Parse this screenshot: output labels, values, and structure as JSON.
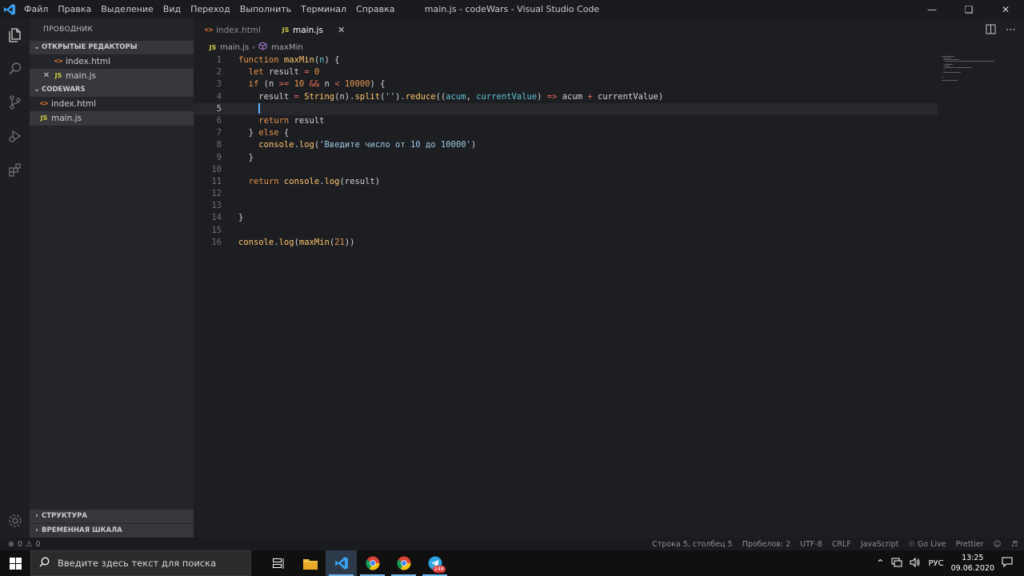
{
  "titlebar": {
    "menu": [
      "Файл",
      "Правка",
      "Выделение",
      "Вид",
      "Переход",
      "Выполнить",
      "Терминал",
      "Справка"
    ],
    "window_title": "main.js - codeWars - Visual Studio Code"
  },
  "sidebar": {
    "title": "ПРОВОДНИК",
    "open_editors_header": "ОТКРЫТЫЕ РЕДАКТОРЫ",
    "open_editors": [
      {
        "name": "index.html",
        "type": "html"
      },
      {
        "name": "main.js",
        "type": "js"
      }
    ],
    "folder_header": "CODEWARS",
    "files": [
      {
        "name": "index.html",
        "type": "html"
      },
      {
        "name": "main.js",
        "type": "js"
      }
    ],
    "outline_header": "СТРУКТУРА",
    "timeline_header": "ВРЕМЕННАЯ ШКАЛА",
    "js_icon": "JS",
    "html_icon": "<>"
  },
  "editor": {
    "tabs": [
      {
        "label": "index.html",
        "type": "html",
        "active": false
      },
      {
        "label": "main.js",
        "type": "js",
        "active": true
      }
    ],
    "breadcrumb": {
      "file": "main.js",
      "symbol": "maxMin"
    },
    "current_line": 5,
    "lines": [
      [
        [
          "kw",
          "function "
        ],
        [
          "fn",
          "maxMin"
        ],
        [
          "plain",
          "("
        ],
        [
          "param",
          "n"
        ],
        [
          "plain",
          ") {"
        ]
      ],
      [
        [
          "plain",
          "  "
        ],
        [
          "kw",
          "let "
        ],
        [
          "plain",
          "result "
        ],
        [
          "op",
          "="
        ],
        [
          "plain",
          " "
        ],
        [
          "num",
          "0"
        ]
      ],
      [
        [
          "plain",
          "  "
        ],
        [
          "kw",
          "if "
        ],
        [
          "plain",
          "(n "
        ],
        [
          "op",
          ">="
        ],
        [
          "plain",
          " "
        ],
        [
          "num",
          "10"
        ],
        [
          "plain",
          " "
        ],
        [
          "op",
          "&&"
        ],
        [
          "plain",
          " n "
        ],
        [
          "op",
          "<"
        ],
        [
          "plain",
          " "
        ],
        [
          "num",
          "10000"
        ],
        [
          "plain",
          ") {"
        ]
      ],
      [
        [
          "plain",
          "    result "
        ],
        [
          "op",
          "="
        ],
        [
          "plain",
          " "
        ],
        [
          "fn",
          "String"
        ],
        [
          "plain",
          "(n)."
        ],
        [
          "fn",
          "split"
        ],
        [
          "plain",
          "("
        ],
        [
          "str",
          "''"
        ],
        [
          "plain",
          ")."
        ],
        [
          "fn",
          "reduce"
        ],
        [
          "plain",
          "(("
        ],
        [
          "param",
          "acum"
        ],
        [
          "plain",
          ", "
        ],
        [
          "param",
          "currentValue"
        ],
        [
          "plain",
          ") "
        ],
        [
          "op",
          "=>"
        ],
        [
          "plain",
          " acum "
        ],
        [
          "op",
          "+"
        ],
        [
          "plain",
          " currentValue)"
        ]
      ],
      [
        [
          "plain",
          "    "
        ]
      ],
      [
        [
          "plain",
          "    "
        ],
        [
          "kw",
          "return "
        ],
        [
          "plain",
          "result"
        ]
      ],
      [
        [
          "plain",
          "  } "
        ],
        [
          "kw",
          "else "
        ],
        [
          "plain",
          "{"
        ]
      ],
      [
        [
          "plain",
          "    "
        ],
        [
          "fn",
          "console"
        ],
        [
          "plain",
          "."
        ],
        [
          "fn",
          "log"
        ],
        [
          "plain",
          "("
        ],
        [
          "str",
          "'Введите число от 10 до 10000'"
        ],
        [
          "plain",
          ")"
        ]
      ],
      [
        [
          "plain",
          "  }"
        ]
      ],
      [],
      [
        [
          "plain",
          "  "
        ],
        [
          "kw",
          "return "
        ],
        [
          "fn",
          "console"
        ],
        [
          "plain",
          "."
        ],
        [
          "fn",
          "log"
        ],
        [
          "plain",
          "(result)"
        ]
      ],
      [],
      [],
      [
        [
          "plain",
          "}"
        ]
      ],
      [],
      [
        [
          "fn",
          "console"
        ],
        [
          "plain",
          "."
        ],
        [
          "fn",
          "log"
        ],
        [
          "plain",
          "("
        ],
        [
          "fn",
          "maxMin"
        ],
        [
          "plain",
          "("
        ],
        [
          "num",
          "21"
        ],
        [
          "plain",
          "))"
        ]
      ]
    ]
  },
  "statusbar": {
    "errors": "0",
    "warnings": "0",
    "position": "Строка 5, столбец 5",
    "spaces": "Пробелов: 2",
    "encoding": "UTF-8",
    "eol": "CRLF",
    "language": "JavaScript",
    "golive": "Go Live",
    "prettier": "Prettier"
  },
  "taskbar": {
    "search_placeholder": "Введите здесь текст для поиска",
    "telegram_badge": "248",
    "lang": "РУС",
    "time": "13:25",
    "date": "09.06.2020"
  },
  "colors": {
    "accent_blue": "#007acc",
    "js_yellow": "#cbcb41",
    "html_orange": "#e37933"
  }
}
